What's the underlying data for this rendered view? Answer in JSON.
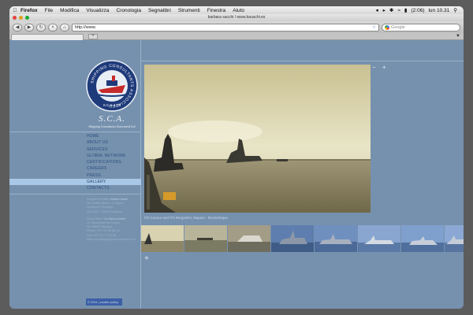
{
  "menubar": {
    "app": "Firefox",
    "items": [
      "File",
      "Modifica",
      "Visualizza",
      "Cronologia",
      "Segnalibri",
      "Strumenti",
      "Finestra",
      "Aiuto"
    ],
    "battery": "(2:06)",
    "clock": "lun 10.31"
  },
  "window": {
    "title": "barbara sacchi / www.bauschi.es"
  },
  "toolbar": {
    "url": "http://www.",
    "search_placeholder": "Google"
  },
  "tabs": {
    "new_tab": "+"
  },
  "site": {
    "brand": "S.C.A.",
    "tagline": "Shipping Consultants Associated Ltd",
    "logo_text": "SHIPPING CONSULTANTS ASSOCIATED",
    "logo_sub": "S.C.A. LTD",
    "nav": [
      "HOME",
      "ABOUT US",
      "SERVICES",
      "GLOBAL NETWORK",
      "CERTIFICATIONS",
      "CAREERS",
      "PRESS",
      "GALLERY",
      "CONTACTS"
    ],
    "active_nav": "GALLERY",
    "address": {
      "reg_label": "Registered Office",
      "reg_name": "Arkha House",
      "reg_lines": [
        "Sth Castle Street - 4 Ogden",
        "Stockport, Cheshire",
        "SK3 8JQ - United Kingdom"
      ],
      "head_label": "Head Office",
      "head_name": "\"La Sanza Arelle\"",
      "head_lines": [
        "1/C Boulevard de Suisse",
        "MC 98000 Monaco",
        "Phone +377 97 98 58 44",
        "Fax +377 97 77 53 08"
      ],
      "mail_label": "Mail",
      "mail": "sca.shipping@sca-monaco.com"
    },
    "footer": "© 2011 | cookie policy"
  },
  "gallery": {
    "controls": "− +",
    "caption": "ITS Cavour and ITS Bergamini, Maputo - Mozambique",
    "more": "+"
  }
}
